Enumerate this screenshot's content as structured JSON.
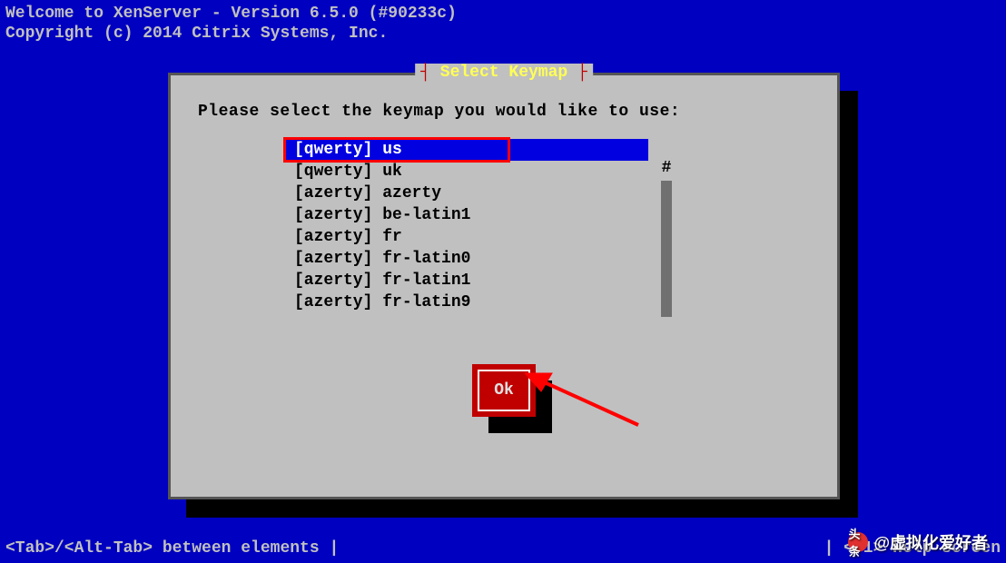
{
  "header": {
    "line1": "Welcome to XenServer - Version 6.5.0 (#90233c)",
    "line2": "Copyright (c) 2014 Citrix Systems, Inc."
  },
  "dialog": {
    "title": "Select Keymap",
    "prompt": "Please select the keymap you would like to use:",
    "items": [
      "[qwerty] us",
      "[qwerty] uk",
      "[azerty] azerty",
      "[azerty] be-latin1",
      "[azerty] fr",
      "[azerty] fr-latin0",
      "[azerty] fr-latin1",
      "[azerty] fr-latin9"
    ],
    "scroll_marker": "#",
    "ok_label": "Ok"
  },
  "footer": {
    "left": "<Tab>/<Alt-Tab> between elements   |",
    "right": "|   <F1> Help screen"
  },
  "watermark": {
    "icon_text": "头条",
    "text": "@虚拟化爱好者"
  }
}
